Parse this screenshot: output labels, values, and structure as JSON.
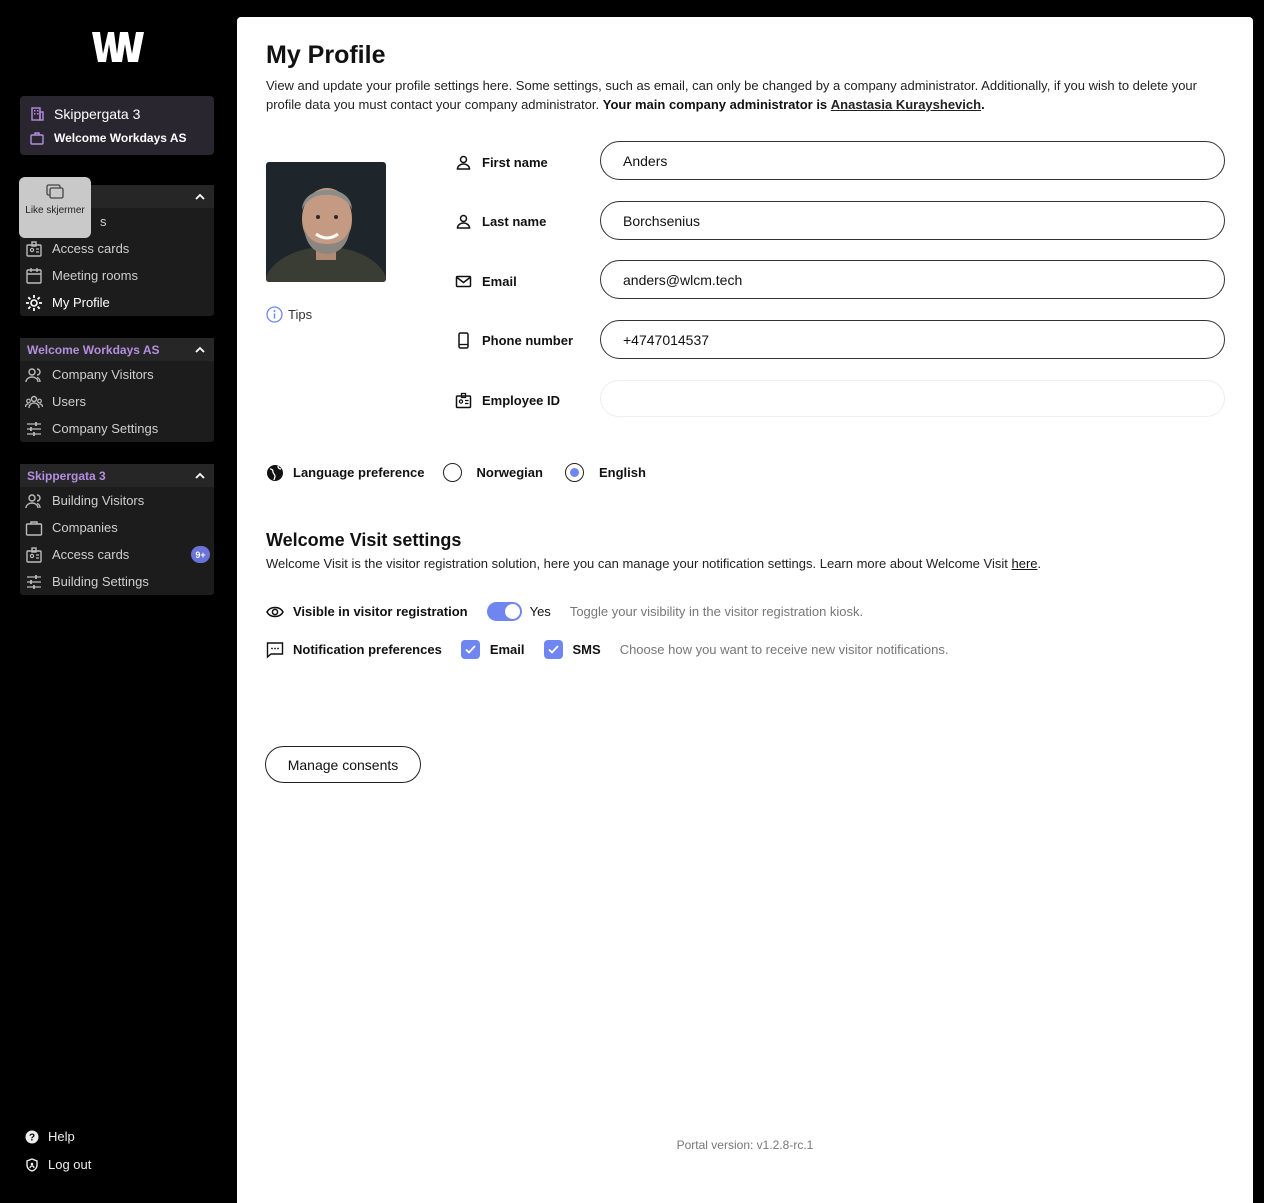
{
  "sidebar": {
    "org_card": {
      "building": "Skippergata 3",
      "company": "Welcome Workdays AS"
    },
    "tooltip_overlay": {
      "label": "Like skjermer"
    },
    "personal_group": {
      "items": [
        {
          "label": "s",
          "icon": "visitors-icon"
        },
        {
          "label": "Access cards",
          "icon": "badge-icon"
        },
        {
          "label": "Meeting rooms",
          "icon": "calendar-icon"
        },
        {
          "label": "My Profile",
          "icon": "gear-icon"
        }
      ]
    },
    "company_group": {
      "title": "Welcome Workdays AS",
      "items": [
        {
          "label": "Company Visitors",
          "icon": "visitors-icon"
        },
        {
          "label": "Users",
          "icon": "users-icon"
        },
        {
          "label": "Company Settings",
          "icon": "sliders-icon"
        }
      ]
    },
    "building_group": {
      "title": "Skippergata 3",
      "items": [
        {
          "label": "Building Visitors",
          "icon": "visitors-icon"
        },
        {
          "label": "Companies",
          "icon": "briefcase-icon"
        },
        {
          "label": "Access cards",
          "icon": "badge-icon",
          "badge": "9+"
        },
        {
          "label": "Building Settings",
          "icon": "sliders-icon"
        }
      ]
    },
    "footer": {
      "help": "Help",
      "logout": "Log out"
    }
  },
  "main": {
    "title": "My Profile",
    "intro_text": "View and update your profile settings here. Some settings, such as email, can only be changed by a company administrator. Additionally, if you wish to delete your profile data you must contact your company administrator.",
    "intro_bold": "Your main company administrator is",
    "admin_name": "Anastasia Kurayshevich",
    "tips": "Tips",
    "fields": {
      "first_name": {
        "label": "First name",
        "value": "Anders"
      },
      "last_name": {
        "label": "Last name",
        "value": "Borchsenius"
      },
      "email": {
        "label": "Email",
        "value": "anders@wlcm.tech"
      },
      "phone": {
        "label": "Phone number",
        "value": "+4747014537"
      },
      "employee_id": {
        "label": "Employee ID",
        "value": ""
      }
    },
    "language": {
      "label": "Language preference",
      "options": [
        "Norwegian",
        "English"
      ],
      "selected": "English"
    },
    "visit": {
      "title": "Welcome Visit settings",
      "desc": "Welcome Visit is the visitor registration solution, here you can manage your notification settings. Learn more about Welcome Visit",
      "link": "here",
      "visible_label": "Visible in visitor registration",
      "visible_state": "Yes",
      "visible_hint": "Toggle your visibility in the visitor registration kiosk.",
      "notif_label": "Notification preferences",
      "notif_email": "Email",
      "notif_sms": "SMS",
      "notif_hint": "Choose how you want to receive new visitor notifications."
    },
    "consent_button": "Manage consents",
    "version": "Portal version: v1.2.8-rc.1"
  },
  "colors": {
    "accent": "#6f86f0",
    "group_title": "#b48ee0"
  }
}
